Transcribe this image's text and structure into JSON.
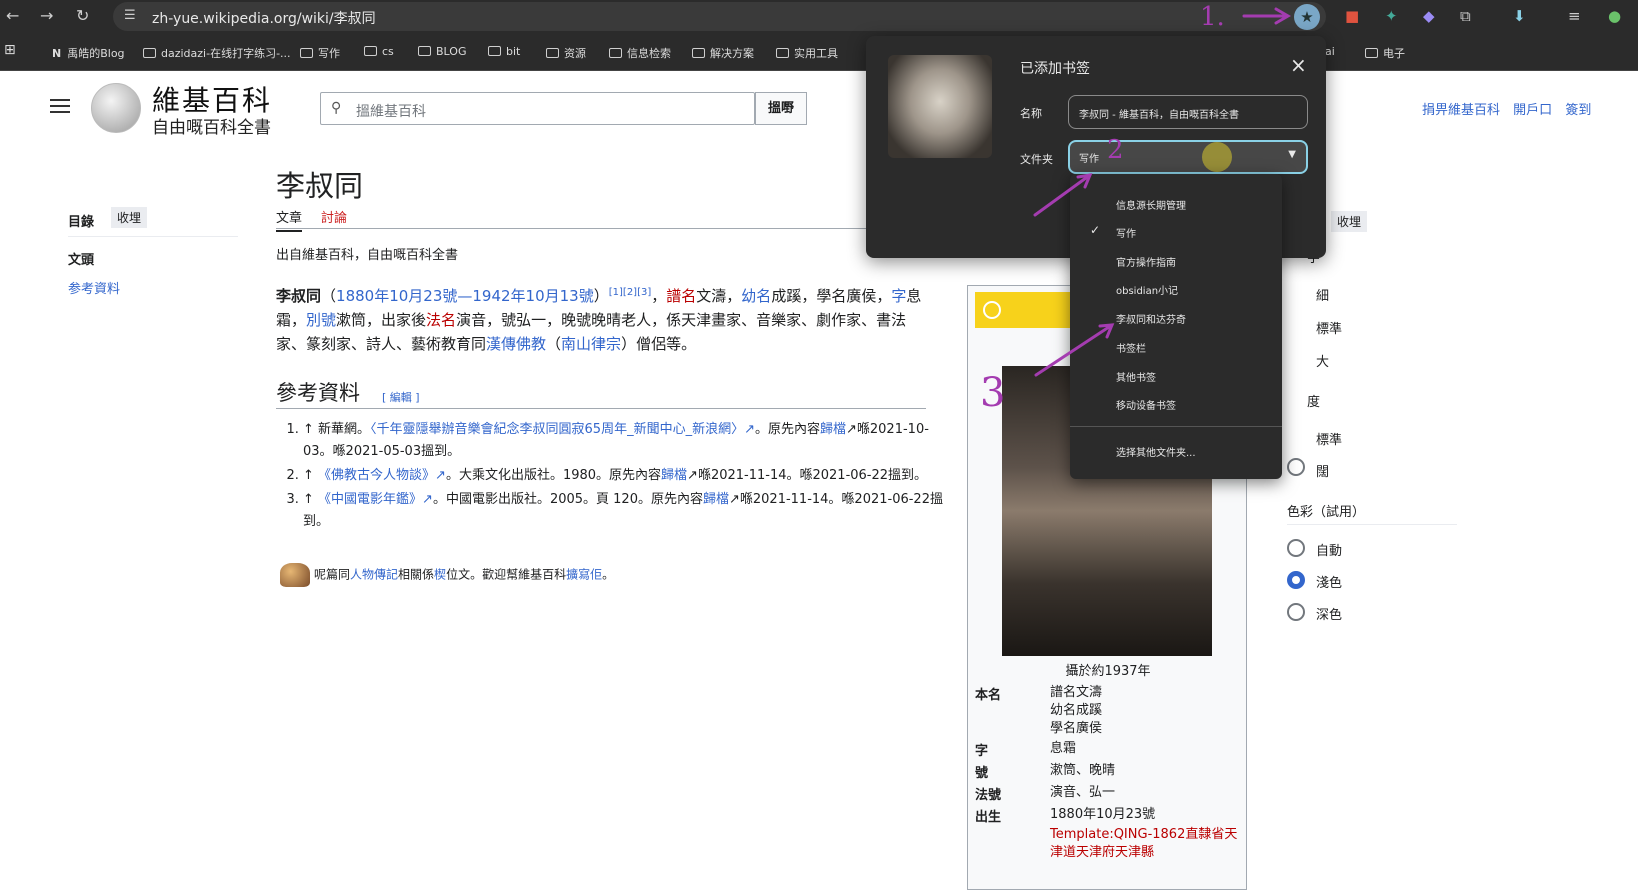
{
  "browser": {
    "url": "zh-yue.wikipedia.org/wiki/李叔同",
    "bookmarks": [
      {
        "label": "禹皓的Blog"
      },
      {
        "label": "dazidazi-在线打字练习-..."
      },
      {
        "label": "写作"
      },
      {
        "label": "cs"
      },
      {
        "label": "BLOG"
      },
      {
        "label": "bit"
      },
      {
        "label": "资源"
      },
      {
        "label": "信息检索"
      },
      {
        "label": "解决方案"
      },
      {
        "label": "实用工具"
      },
      {
        "label": "ai"
      },
      {
        "label": "电子"
      }
    ],
    "icons": [
      "back-icon",
      "forward-icon",
      "reload-icon",
      "tune-icon",
      "bookmark-star-icon",
      "extensions-icon",
      "download-icon"
    ]
  },
  "wiki": {
    "logo_title": "維基百科",
    "logo_sub": "自由嘅百科全書",
    "search_placeholder": "搵維基百科",
    "search_button": "搵嘢",
    "top_links": [
      "捐畀維基百科",
      "開戶口",
      "簽到"
    ],
    "toc_title": "目錄",
    "toc_hide": "收埋",
    "toc_items": [
      "文頭",
      "参考資料"
    ],
    "title": "李叔同",
    "tab_article": "文章",
    "tab_talk": "討論",
    "from_line": "出自維基百科，自由嘅百科全書",
    "lead": {
      "name": "李叔同",
      "dates": "1880年10月23號—1942年10月13號",
      "refs": "[1][2][3]",
      "p1": "，",
      "pu_ming": "譜名",
      "p2": "文濤，",
      "you_ming": "幼名",
      "p3": "成蹊，學名廣侯，",
      "zi": "字",
      "p4": "息霜，",
      "hao": "別號",
      "p5": "漱筒，出家後",
      "fa_ming": "法名",
      "p6": "演音，號弘一，晚號晚晴老人，係天津畫家、音樂家、劇作家、書法家、篆刻家、詩人、藝術教育同",
      "han_buddhism": "漢傳佛教",
      "p7": "（",
      "nanshan": "南山律宗",
      "p8": "）僧侶等。"
    },
    "section_title": "參考資料",
    "section_edit": "[ 編輯 ]",
    "references": [
      {
        "pre": "↑ 新華網。",
        "link": "〈千年靈隱舉辦音樂會紀念李叔同圓寂65周年_新聞中心_新浪網〉↗",
        "post": "。原先內容",
        "arch": "歸檔",
        "tail": "↗喺2021-10-03。喺2021-05-03搵到。"
      },
      {
        "pre": "↑ ",
        "link": "《佛教古今人物談》↗",
        "post": "。大乘文化出版社。1980。原先內容",
        "arch": "歸檔",
        "tail": "↗喺2021-11-14。喺2021-06-22搵到。"
      },
      {
        "pre": "↑ ",
        "link": "《中國電影年鑑》↗",
        "post": "。中國電影出版社。2005。頁 120。原先內容",
        "arch": "歸檔",
        "tail": "↗喺2021-11-14。喺2021-06-22搵到。"
      }
    ],
    "stub": {
      "pre": "呢篇同",
      "link1": "人物傳記",
      "mid": "相關係",
      "link2": "楔",
      "mid2": "位文。歡迎幫維基百科",
      "link3": "擴寫佢",
      "post": "。"
    },
    "infobox": {
      "caption": "攝於約1937年",
      "rows": [
        {
          "k": "本名",
          "v": "譜名文濤\n幼名成蹊\n學名廣侯"
        },
        {
          "k": "字",
          "v": "息霜"
        },
        {
          "k": "號",
          "v": "漱筒、晚晴"
        },
        {
          "k": "法號",
          "v": "演音、弘一"
        },
        {
          "k": "出生",
          "v": "1880年10月23號"
        }
      ],
      "template_err": "Template:QING-1862直隸省天津道天津府天津縣"
    },
    "right_panel": {
      "hide": "收埋",
      "fragments": [
        "字",
        "細",
        "標準",
        "大",
        "度",
        "標準",
        "闊"
      ],
      "color_title": "色彩（試用）",
      "color_options": [
        "自動",
        "淺色",
        "深色"
      ],
      "color_selected": "淺色"
    }
  },
  "bookmark_dialog": {
    "title": "已添加书签",
    "name_label": "名称",
    "name_value": "李叔同 - 維基百科，自由嘅百科全書",
    "folder_label": "文件夹",
    "folder_value": "写作",
    "menu": [
      "信息源长期管理",
      "写作",
      "官方操作指南",
      "obsidian小记",
      "李叔同和达芬奇",
      "书签栏",
      "其他书签",
      "移动设备书签"
    ],
    "menu_checked": "写作",
    "menu_more": "选择其他文件夹..."
  },
  "annotations": [
    "1.",
    "2",
    "3"
  ],
  "colors": {
    "accent": "#a43cb0",
    "link": "#3366cc",
    "focus": "#8ad1e6"
  }
}
